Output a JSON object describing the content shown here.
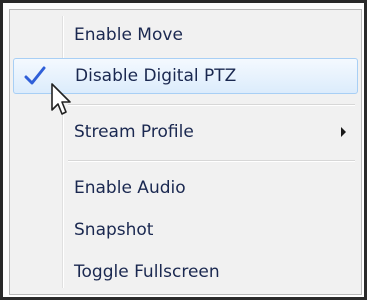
{
  "context_menu": {
    "items": [
      {
        "label": "Enable Move",
        "checked": false,
        "has_submenu": false
      },
      {
        "label": "Disable Digital PTZ",
        "checked": true,
        "has_submenu": false,
        "highlighted": true
      },
      {
        "label": "Stream Profile",
        "checked": false,
        "has_submenu": true
      },
      {
        "label": "Enable Audio",
        "checked": false,
        "has_submenu": false
      },
      {
        "label": "Snapshot",
        "checked": false,
        "has_submenu": false
      },
      {
        "label": "Toggle Fullscreen",
        "checked": false,
        "has_submenu": false
      }
    ],
    "icons": {
      "check": "check-icon",
      "submenu": "submenu-arrow-icon",
      "cursor": "mouse-pointer-icon"
    },
    "colors": {
      "text": "#1a2850",
      "check": "#2f5fd8",
      "highlight_border": "#a8cff5",
      "highlight_fill": "#dcecfc",
      "menu_background": "#f1f1f1"
    }
  }
}
